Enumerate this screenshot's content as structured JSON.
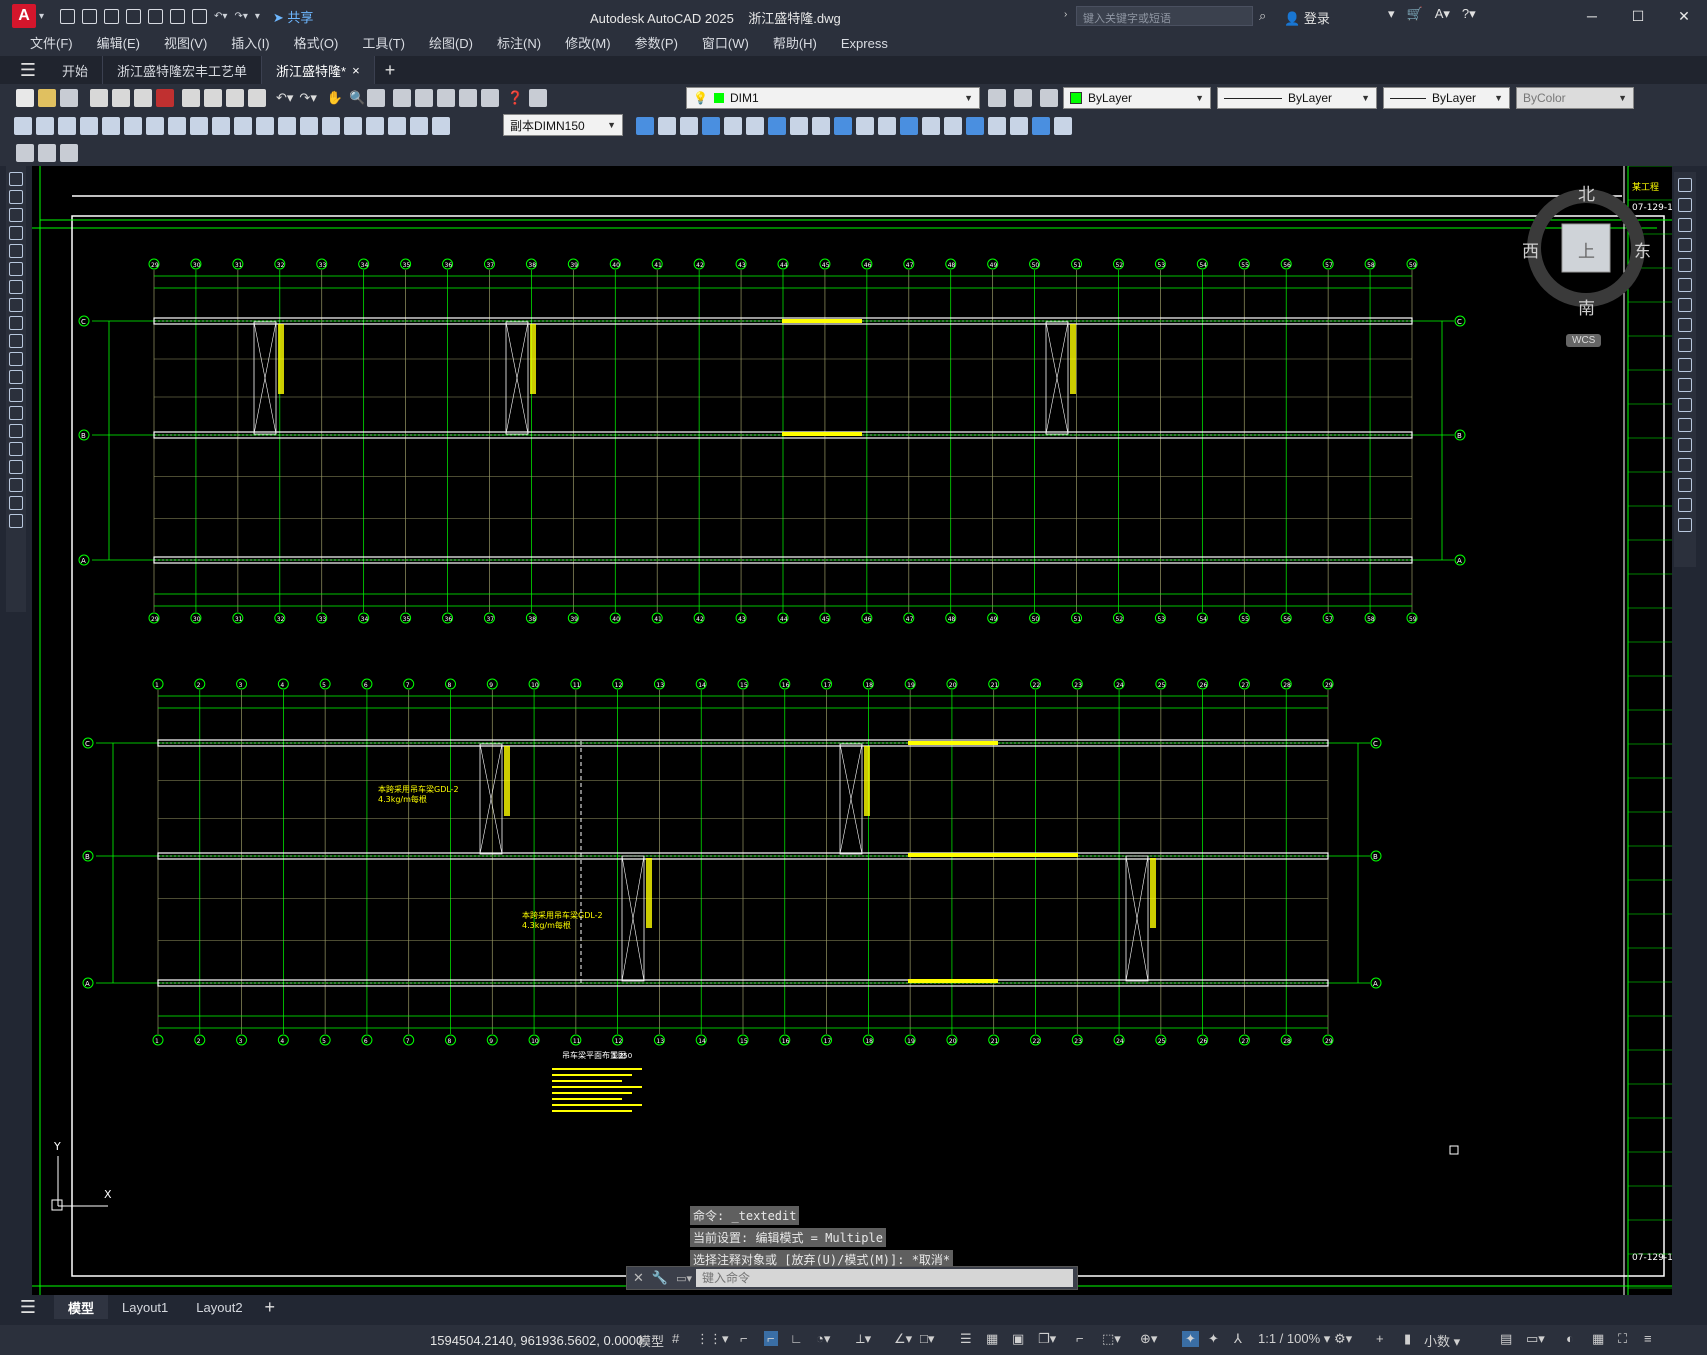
{
  "app": {
    "logo_letter": "A",
    "title": "Autodesk AutoCAD 2025",
    "file_name": "浙江盛特隆.dwg",
    "share_label": "共享",
    "search_placeholder": "键入关键字或短语",
    "user_label": "登录"
  },
  "menu": [
    "文件(F)",
    "编辑(E)",
    "视图(V)",
    "插入(I)",
    "格式(O)",
    "工具(T)",
    "绘图(D)",
    "标注(N)",
    "修改(M)",
    "参数(P)",
    "窗口(W)",
    "帮助(H)",
    "Express"
  ],
  "doc_tabs": [
    {
      "label": "开始",
      "active": false
    },
    {
      "label": "浙江盛特隆宏丰工艺单",
      "active": false
    },
    {
      "label": "浙江盛特隆*",
      "active": true
    }
  ],
  "toolbar": {
    "layer_name": "DIM1",
    "color_combo": "ByLayer",
    "linetype_combo": "ByLayer",
    "lineweight_combo": "ByLayer",
    "plotstyle_combo": "ByColor",
    "dimstyle_combo": "副本DIMN150"
  },
  "viewcube": {
    "north": "北",
    "south": "南",
    "east": "东",
    "west": "西",
    "top": "上",
    "wcs": "WCS"
  },
  "drawing": {
    "plan1_top": [
      "29",
      "30",
      "31",
      "32",
      "33",
      "34",
      "35",
      "36",
      "37",
      "38",
      "39",
      "40",
      "41",
      "42",
      "43",
      "44",
      "45",
      "46",
      "47",
      "48",
      "49",
      "50",
      "51",
      "52",
      "53",
      "54",
      "55",
      "56",
      "57",
      "58",
      "59"
    ],
    "plan2_top": [
      "1",
      "2",
      "3",
      "4",
      "5",
      "6",
      "7",
      "8",
      "9",
      "10",
      "11",
      "12",
      "13",
      "14",
      "15",
      "16",
      "17",
      "18",
      "19",
      "20",
      "21",
      "22",
      "23",
      "24",
      "25",
      "26",
      "27",
      "28",
      "29"
    ],
    "rows": [
      "C",
      "B",
      "A"
    ],
    "note1": "本跨采用吊车梁GDL-2",
    "note1b": "4.3kg/m每根",
    "note2": "本跨采用吊车梁GDL-2",
    "note2b": "4.3kg/m每根",
    "section_title": "吊车梁平面布置图",
    "section_scale": "1:250",
    "title_block_top": "某工程",
    "drawing_no": "07-129-1"
  },
  "command": {
    "history": [
      "命令: _textedit",
      "当前设置: 编辑模式 = Multiple",
      "选择注释对象或 [放弃(U)/模式(M)]: *取消*"
    ],
    "placeholder": "键入命令"
  },
  "layout_tabs": [
    {
      "label": "模型",
      "active": true
    },
    {
      "label": "Layout1",
      "active": false
    },
    {
      "label": "Layout2",
      "active": false
    }
  ],
  "status": {
    "coords": "1594504.2140, 961936.5602, 0.0000",
    "space": "模型",
    "scale": "1:1 / 100%",
    "units": "小数"
  },
  "colors": {
    "bg": "#000000",
    "grid_green": "#00ff00",
    "beam_white": "#ffffff",
    "text_yellow": "#ffff00",
    "ui_dark": "#2b303c"
  }
}
